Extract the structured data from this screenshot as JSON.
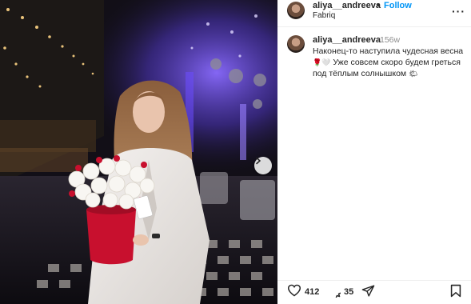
{
  "post": {
    "username": "aliya__andreeva",
    "follow_label": "Follow",
    "location": "Fabriq",
    "time_ago": "156w",
    "caption_line1": "Наконец-то наступила чудесная весна",
    "caption_line2": "Уже совсем скоро будем греться",
    "caption_line3": "под тёплым солнышком",
    "likes": "412",
    "comments": "35",
    "more_label": "···"
  },
  "icons": {
    "more": "more-icon",
    "heart": "heart-icon",
    "comment": "comment-icon",
    "share": "share-icon",
    "bookmark": "bookmark-icon",
    "next": "chevron-right-icon"
  },
  "colors": {
    "follow_blue": "#0095f6",
    "text_primary": "#262626",
    "text_muted": "#8e8e8e",
    "club_purple": "#7a5cff",
    "rose_red": "#c8102e"
  }
}
